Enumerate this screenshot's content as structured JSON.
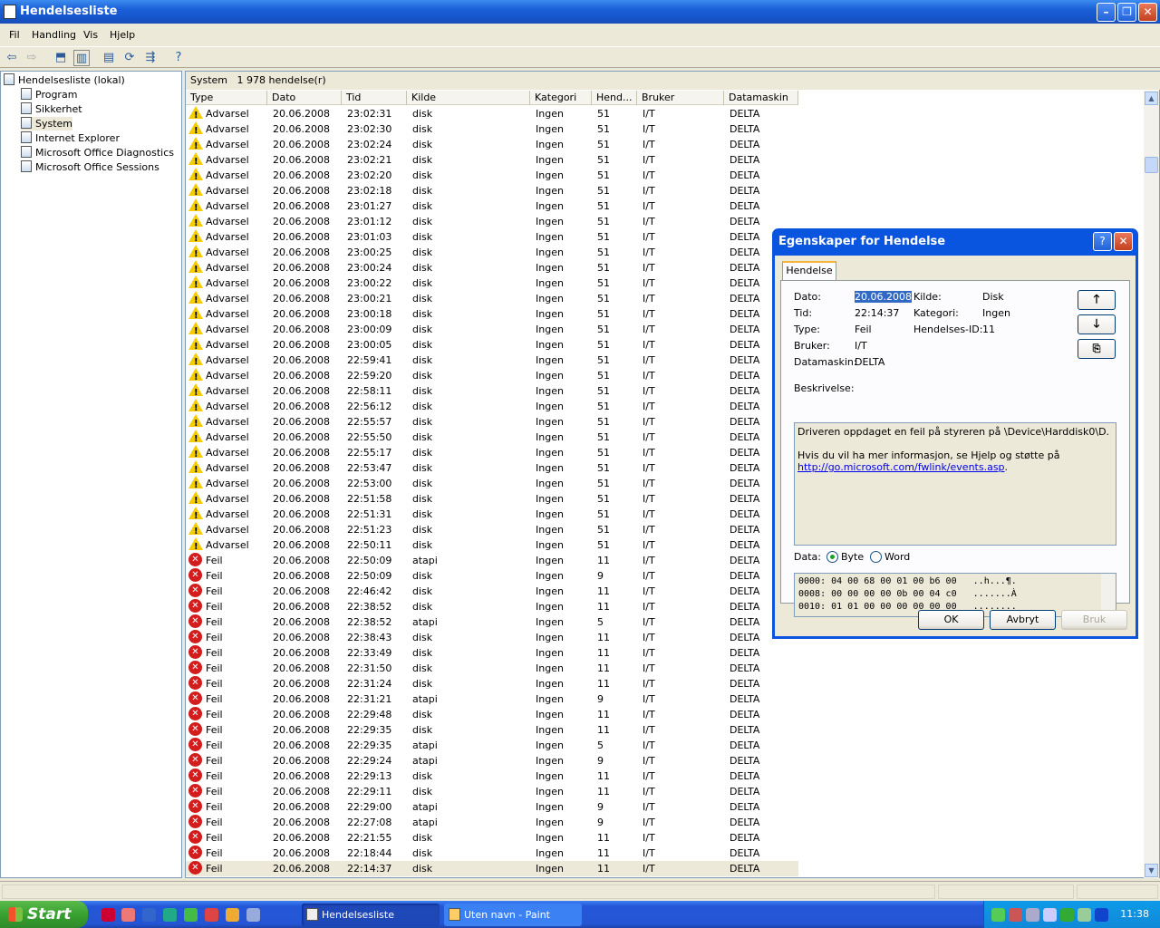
{
  "window": {
    "title": "Hendelsesliste"
  },
  "menu": [
    "Fil",
    "Handling",
    "Vis",
    "Hjelp"
  ],
  "tree": {
    "root": "Hendelsesliste (lokal)",
    "items": [
      "Program",
      "Sikkerhet",
      "System",
      "Internet Explorer",
      "Microsoft Office Diagnostics",
      "Microsoft Office Sessions"
    ],
    "selected": "System"
  },
  "list": {
    "header_name": "System",
    "header_count": "1 978 hendelse(r)",
    "columns": [
      "Type",
      "Dato",
      "Tid",
      "Kilde",
      "Kategori",
      "Hend...",
      "Bruker",
      "Datamaskin"
    ],
    "rows": [
      [
        "warn",
        "Advarsel",
        "20.06.2008",
        "23:02:31",
        "disk",
        "Ingen",
        "51",
        "I/T",
        "DELTA"
      ],
      [
        "warn",
        "Advarsel",
        "20.06.2008",
        "23:02:30",
        "disk",
        "Ingen",
        "51",
        "I/T",
        "DELTA"
      ],
      [
        "warn",
        "Advarsel",
        "20.06.2008",
        "23:02:24",
        "disk",
        "Ingen",
        "51",
        "I/T",
        "DELTA"
      ],
      [
        "warn",
        "Advarsel",
        "20.06.2008",
        "23:02:21",
        "disk",
        "Ingen",
        "51",
        "I/T",
        "DELTA"
      ],
      [
        "warn",
        "Advarsel",
        "20.06.2008",
        "23:02:20",
        "disk",
        "Ingen",
        "51",
        "I/T",
        "DELTA"
      ],
      [
        "warn",
        "Advarsel",
        "20.06.2008",
        "23:02:18",
        "disk",
        "Ingen",
        "51",
        "I/T",
        "DELTA"
      ],
      [
        "warn",
        "Advarsel",
        "20.06.2008",
        "23:01:27",
        "disk",
        "Ingen",
        "51",
        "I/T",
        "DELTA"
      ],
      [
        "warn",
        "Advarsel",
        "20.06.2008",
        "23:01:12",
        "disk",
        "Ingen",
        "51",
        "I/T",
        "DELTA"
      ],
      [
        "warn",
        "Advarsel",
        "20.06.2008",
        "23:01:03",
        "disk",
        "Ingen",
        "51",
        "I/T",
        "DELTA"
      ],
      [
        "warn",
        "Advarsel",
        "20.06.2008",
        "23:00:25",
        "disk",
        "Ingen",
        "51",
        "I/T",
        "DELTA"
      ],
      [
        "warn",
        "Advarsel",
        "20.06.2008",
        "23:00:24",
        "disk",
        "Ingen",
        "51",
        "I/T",
        "DELTA"
      ],
      [
        "warn",
        "Advarsel",
        "20.06.2008",
        "23:00:22",
        "disk",
        "Ingen",
        "51",
        "I/T",
        "DELTA"
      ],
      [
        "warn",
        "Advarsel",
        "20.06.2008",
        "23:00:21",
        "disk",
        "Ingen",
        "51",
        "I/T",
        "DELTA"
      ],
      [
        "warn",
        "Advarsel",
        "20.06.2008",
        "23:00:18",
        "disk",
        "Ingen",
        "51",
        "I/T",
        "DELTA"
      ],
      [
        "warn",
        "Advarsel",
        "20.06.2008",
        "23:00:09",
        "disk",
        "Ingen",
        "51",
        "I/T",
        "DELTA"
      ],
      [
        "warn",
        "Advarsel",
        "20.06.2008",
        "23:00:05",
        "disk",
        "Ingen",
        "51",
        "I/T",
        "DELTA"
      ],
      [
        "warn",
        "Advarsel",
        "20.06.2008",
        "22:59:41",
        "disk",
        "Ingen",
        "51",
        "I/T",
        "DELTA"
      ],
      [
        "warn",
        "Advarsel",
        "20.06.2008",
        "22:59:20",
        "disk",
        "Ingen",
        "51",
        "I/T",
        "DELTA"
      ],
      [
        "warn",
        "Advarsel",
        "20.06.2008",
        "22:58:11",
        "disk",
        "Ingen",
        "51",
        "I/T",
        "DELTA"
      ],
      [
        "warn",
        "Advarsel",
        "20.06.2008",
        "22:56:12",
        "disk",
        "Ingen",
        "51",
        "I/T",
        "DELTA"
      ],
      [
        "warn",
        "Advarsel",
        "20.06.2008",
        "22:55:57",
        "disk",
        "Ingen",
        "51",
        "I/T",
        "DELTA"
      ],
      [
        "warn",
        "Advarsel",
        "20.06.2008",
        "22:55:50",
        "disk",
        "Ingen",
        "51",
        "I/T",
        "DELTA"
      ],
      [
        "warn",
        "Advarsel",
        "20.06.2008",
        "22:55:17",
        "disk",
        "Ingen",
        "51",
        "I/T",
        "DELTA"
      ],
      [
        "warn",
        "Advarsel",
        "20.06.2008",
        "22:53:47",
        "disk",
        "Ingen",
        "51",
        "I/T",
        "DELTA"
      ],
      [
        "warn",
        "Advarsel",
        "20.06.2008",
        "22:53:00",
        "disk",
        "Ingen",
        "51",
        "I/T",
        "DELTA"
      ],
      [
        "warn",
        "Advarsel",
        "20.06.2008",
        "22:51:58",
        "disk",
        "Ingen",
        "51",
        "I/T",
        "DELTA"
      ],
      [
        "warn",
        "Advarsel",
        "20.06.2008",
        "22:51:31",
        "disk",
        "Ingen",
        "51",
        "I/T",
        "DELTA"
      ],
      [
        "warn",
        "Advarsel",
        "20.06.2008",
        "22:51:23",
        "disk",
        "Ingen",
        "51",
        "I/T",
        "DELTA"
      ],
      [
        "warn",
        "Advarsel",
        "20.06.2008",
        "22:50:11",
        "disk",
        "Ingen",
        "51",
        "I/T",
        "DELTA"
      ],
      [
        "err",
        "Feil",
        "20.06.2008",
        "22:50:09",
        "atapi",
        "Ingen",
        "11",
        "I/T",
        "DELTA"
      ],
      [
        "err",
        "Feil",
        "20.06.2008",
        "22:50:09",
        "disk",
        "Ingen",
        "9",
        "I/T",
        "DELTA"
      ],
      [
        "err",
        "Feil",
        "20.06.2008",
        "22:46:42",
        "disk",
        "Ingen",
        "11",
        "I/T",
        "DELTA"
      ],
      [
        "err",
        "Feil",
        "20.06.2008",
        "22:38:52",
        "disk",
        "Ingen",
        "11",
        "I/T",
        "DELTA"
      ],
      [
        "err",
        "Feil",
        "20.06.2008",
        "22:38:52",
        "atapi",
        "Ingen",
        "5",
        "I/T",
        "DELTA"
      ],
      [
        "err",
        "Feil",
        "20.06.2008",
        "22:38:43",
        "disk",
        "Ingen",
        "11",
        "I/T",
        "DELTA"
      ],
      [
        "err",
        "Feil",
        "20.06.2008",
        "22:33:49",
        "disk",
        "Ingen",
        "11",
        "I/T",
        "DELTA"
      ],
      [
        "err",
        "Feil",
        "20.06.2008",
        "22:31:50",
        "disk",
        "Ingen",
        "11",
        "I/T",
        "DELTA"
      ],
      [
        "err",
        "Feil",
        "20.06.2008",
        "22:31:24",
        "disk",
        "Ingen",
        "11",
        "I/T",
        "DELTA"
      ],
      [
        "err",
        "Feil",
        "20.06.2008",
        "22:31:21",
        "atapi",
        "Ingen",
        "9",
        "I/T",
        "DELTA"
      ],
      [
        "err",
        "Feil",
        "20.06.2008",
        "22:29:48",
        "disk",
        "Ingen",
        "11",
        "I/T",
        "DELTA"
      ],
      [
        "err",
        "Feil",
        "20.06.2008",
        "22:29:35",
        "disk",
        "Ingen",
        "11",
        "I/T",
        "DELTA"
      ],
      [
        "err",
        "Feil",
        "20.06.2008",
        "22:29:35",
        "atapi",
        "Ingen",
        "5",
        "I/T",
        "DELTA"
      ],
      [
        "err",
        "Feil",
        "20.06.2008",
        "22:29:24",
        "atapi",
        "Ingen",
        "9",
        "I/T",
        "DELTA"
      ],
      [
        "err",
        "Feil",
        "20.06.2008",
        "22:29:13",
        "disk",
        "Ingen",
        "11",
        "I/T",
        "DELTA"
      ],
      [
        "err",
        "Feil",
        "20.06.2008",
        "22:29:11",
        "disk",
        "Ingen",
        "11",
        "I/T",
        "DELTA"
      ],
      [
        "err",
        "Feil",
        "20.06.2008",
        "22:29:00",
        "atapi",
        "Ingen",
        "9",
        "I/T",
        "DELTA"
      ],
      [
        "err",
        "Feil",
        "20.06.2008",
        "22:27:08",
        "atapi",
        "Ingen",
        "9",
        "I/T",
        "DELTA"
      ],
      [
        "err",
        "Feil",
        "20.06.2008",
        "22:21:55",
        "disk",
        "Ingen",
        "11",
        "I/T",
        "DELTA"
      ],
      [
        "err",
        "Feil",
        "20.06.2008",
        "22:18:44",
        "disk",
        "Ingen",
        "11",
        "I/T",
        "DELTA"
      ],
      [
        "err",
        "Feil",
        "20.06.2008",
        "22:14:37",
        "disk",
        "Ingen",
        "11",
        "I/T",
        "DELTA"
      ]
    ]
  },
  "dialog": {
    "title": "Egenskaper for Hendelse",
    "tab": "Hendelse",
    "labels": {
      "date": "Dato:",
      "time": "Tid:",
      "type": "Type:",
      "user": "Bruker:",
      "computer": "Datamaskin:",
      "source": "Kilde:",
      "category": "Kategori:",
      "event_id": "Hendelses-ID:",
      "description": "Beskrivelse:",
      "data": "Data:",
      "byte": "Byte",
      "word": "Word"
    },
    "values": {
      "date": "20.06.2008",
      "time": "22:14:37",
      "type": "Feil",
      "user": "I/T",
      "computer": "DELTA",
      "source": "Disk",
      "category": "Ingen",
      "event_id": "11"
    },
    "description_line1": "Driveren oppdaget en feil på styreren på \\Device\\Harddisk0\\D.",
    "description_line2": "Hvis du vil ha mer informasjon, se Hjelp og støtte på",
    "description_link": "http://go.microsoft.com/fwlink/events.asp",
    "description_end": ".",
    "hex": [
      "0000: 04 00 68 00 01 00 b6 00   ..h...¶.",
      "0008: 00 00 00 00 0b 00 04 c0   .......À",
      "0010: 01 01 00 00 00 00 00 00   ........"
    ],
    "buttons": {
      "ok": "OK",
      "cancel": "Avbryt",
      "apply": "Bruk"
    }
  },
  "taskbar": {
    "start": "Start",
    "tasks": [
      "Hendelsesliste",
      "Uten navn - Paint"
    ],
    "clock": "11:38"
  },
  "colors": {
    "titlebar": "#1553c8",
    "taskbar": "#2456d8",
    "start": "#38a130",
    "warning": "#f5cc00",
    "error": "#d31d1d"
  }
}
